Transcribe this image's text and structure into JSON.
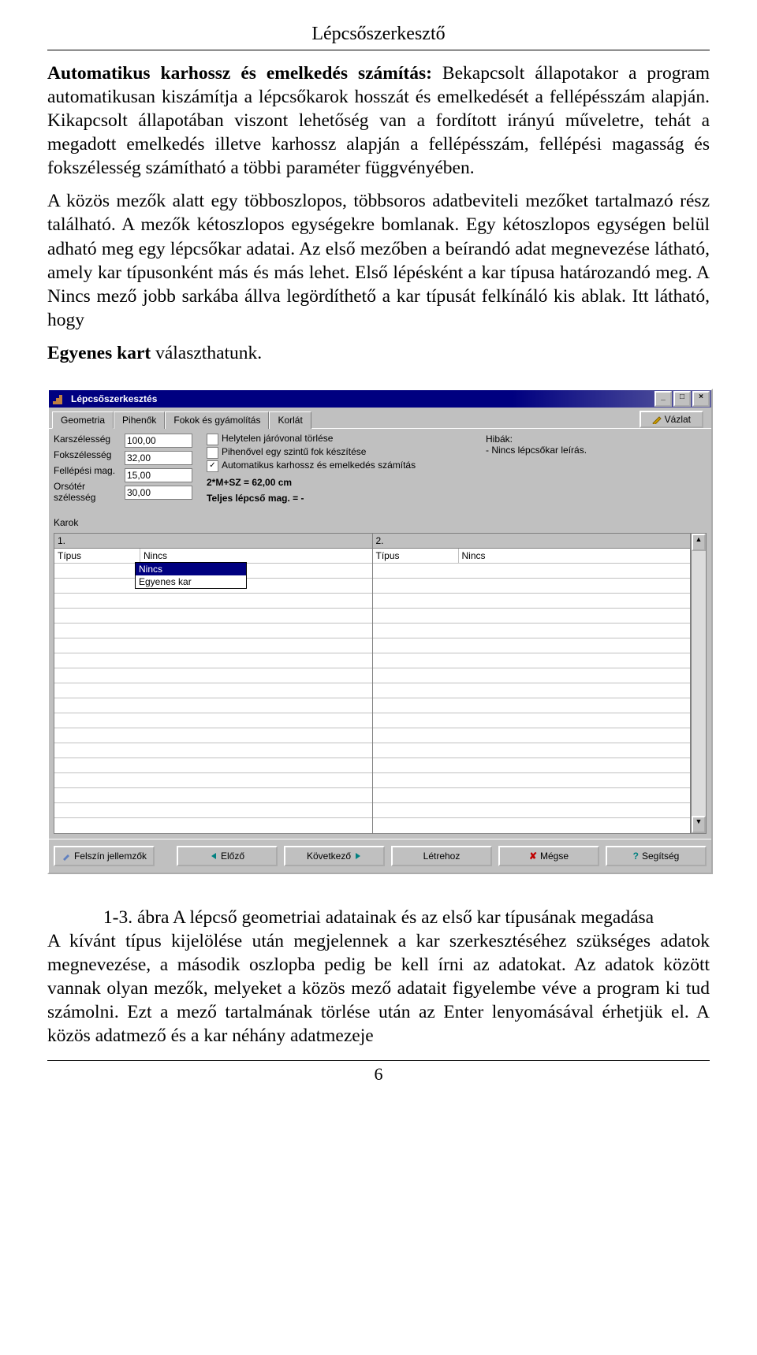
{
  "header": "Lépcsőszerkesztő",
  "intro_bold": "Automatikus karhossz és emelkedés számítás:",
  "intro_rest": "Bekapcsolt állapotakor a program automatikusan kiszámítja a lépcsőkarok hosszát és emelkedését a fellépésszám alapján. Kikapcsolt állapotában viszont lehetőség van a fordított irányú műveletre, tehát a megadott emelkedés illetve karhossz alapján a fellépésszám, fellépési magasság és fokszélesség számítható a többi paraméter függvényében.",
  "para2_pre": "A közös mezők alatt egy többoszlopos, többsoros adatbeviteli mezőket tartalmazó rész található. A mezők kétoszlopos egységekre bomlanak. Egy kétoszlopos egységen belül adható meg egy lépcsőkar adatai. Az első mezőben a beírandó adat megnevezése látható, amely kar típusonként más és más lehet. Első lépésként a kar típusa határozandó meg. A Nincs mező jobb sarkába állva legördíthető a kar típusát felkínáló kis ablak. Itt látható, hogy",
  "line3_bold": "Egyenes kart",
  "line3_rest": " választhatunk.",
  "dialog": {
    "title": "Lépcsőszerkesztés",
    "tabs": [
      "Geometria",
      "Pihenők",
      "Fokok és gyámolítás",
      "Korlát"
    ],
    "vazlat": "Vázlat",
    "labels": {
      "karszelesseg": "Karszélesség",
      "fokszelesseg": "Fokszélesség",
      "fellepesi": "Fellépési mag.",
      "orso": "Orsótér szélesség",
      "karok": "Karok"
    },
    "values": {
      "karszelesseg": "100,00",
      "fokszelesseg": "32,00",
      "fellepesi": "15,00",
      "orso": "30,00"
    },
    "checkboxes": {
      "c1": "Helytelen járóvonal törlése",
      "c2": "Pihenővel egy szintű fok készítése",
      "c3": "Automatikus karhossz és emelkedés számítás"
    },
    "formula": "2*M+SZ = 62,00 cm",
    "teljes": "Teljes lépcső mag. = -",
    "hibak_label": "Hibák:",
    "hibak_text": "- Nincs lépcsőkar leírás.",
    "grid": {
      "col1_head": "1.",
      "col2_head": "2.",
      "row_label": "Típus",
      "row_val": "Nincs",
      "dropdown": [
        "Nincs",
        "Egyenes kar"
      ]
    },
    "buttons": {
      "felszin": "Felszín jellemzők",
      "elozo": "Előző",
      "kovetkezo": "Következő",
      "letrehoz": "Létrehoz",
      "megse": "Mégse",
      "segitseg": "Segítség"
    }
  },
  "caption1": "1-3. ábra A lépcső geometriai adatainak és az első kar típusának megadása",
  "caption2": "A kívánt típus kijelölése után megjelennek a kar szerkesztéséhez szükséges adatok megnevezése, a második oszlopba pedig be kell írni az adatokat. Az adatok között vannak olyan mezők, melyeket a közös mező adatait figyelembe véve a program ki tud számolni. Ezt a mező tartalmának törlése után az Enter lenyomásával érhetjük el. A közös adatmező és a kar néhány adatmezeje",
  "pagenum": "6"
}
